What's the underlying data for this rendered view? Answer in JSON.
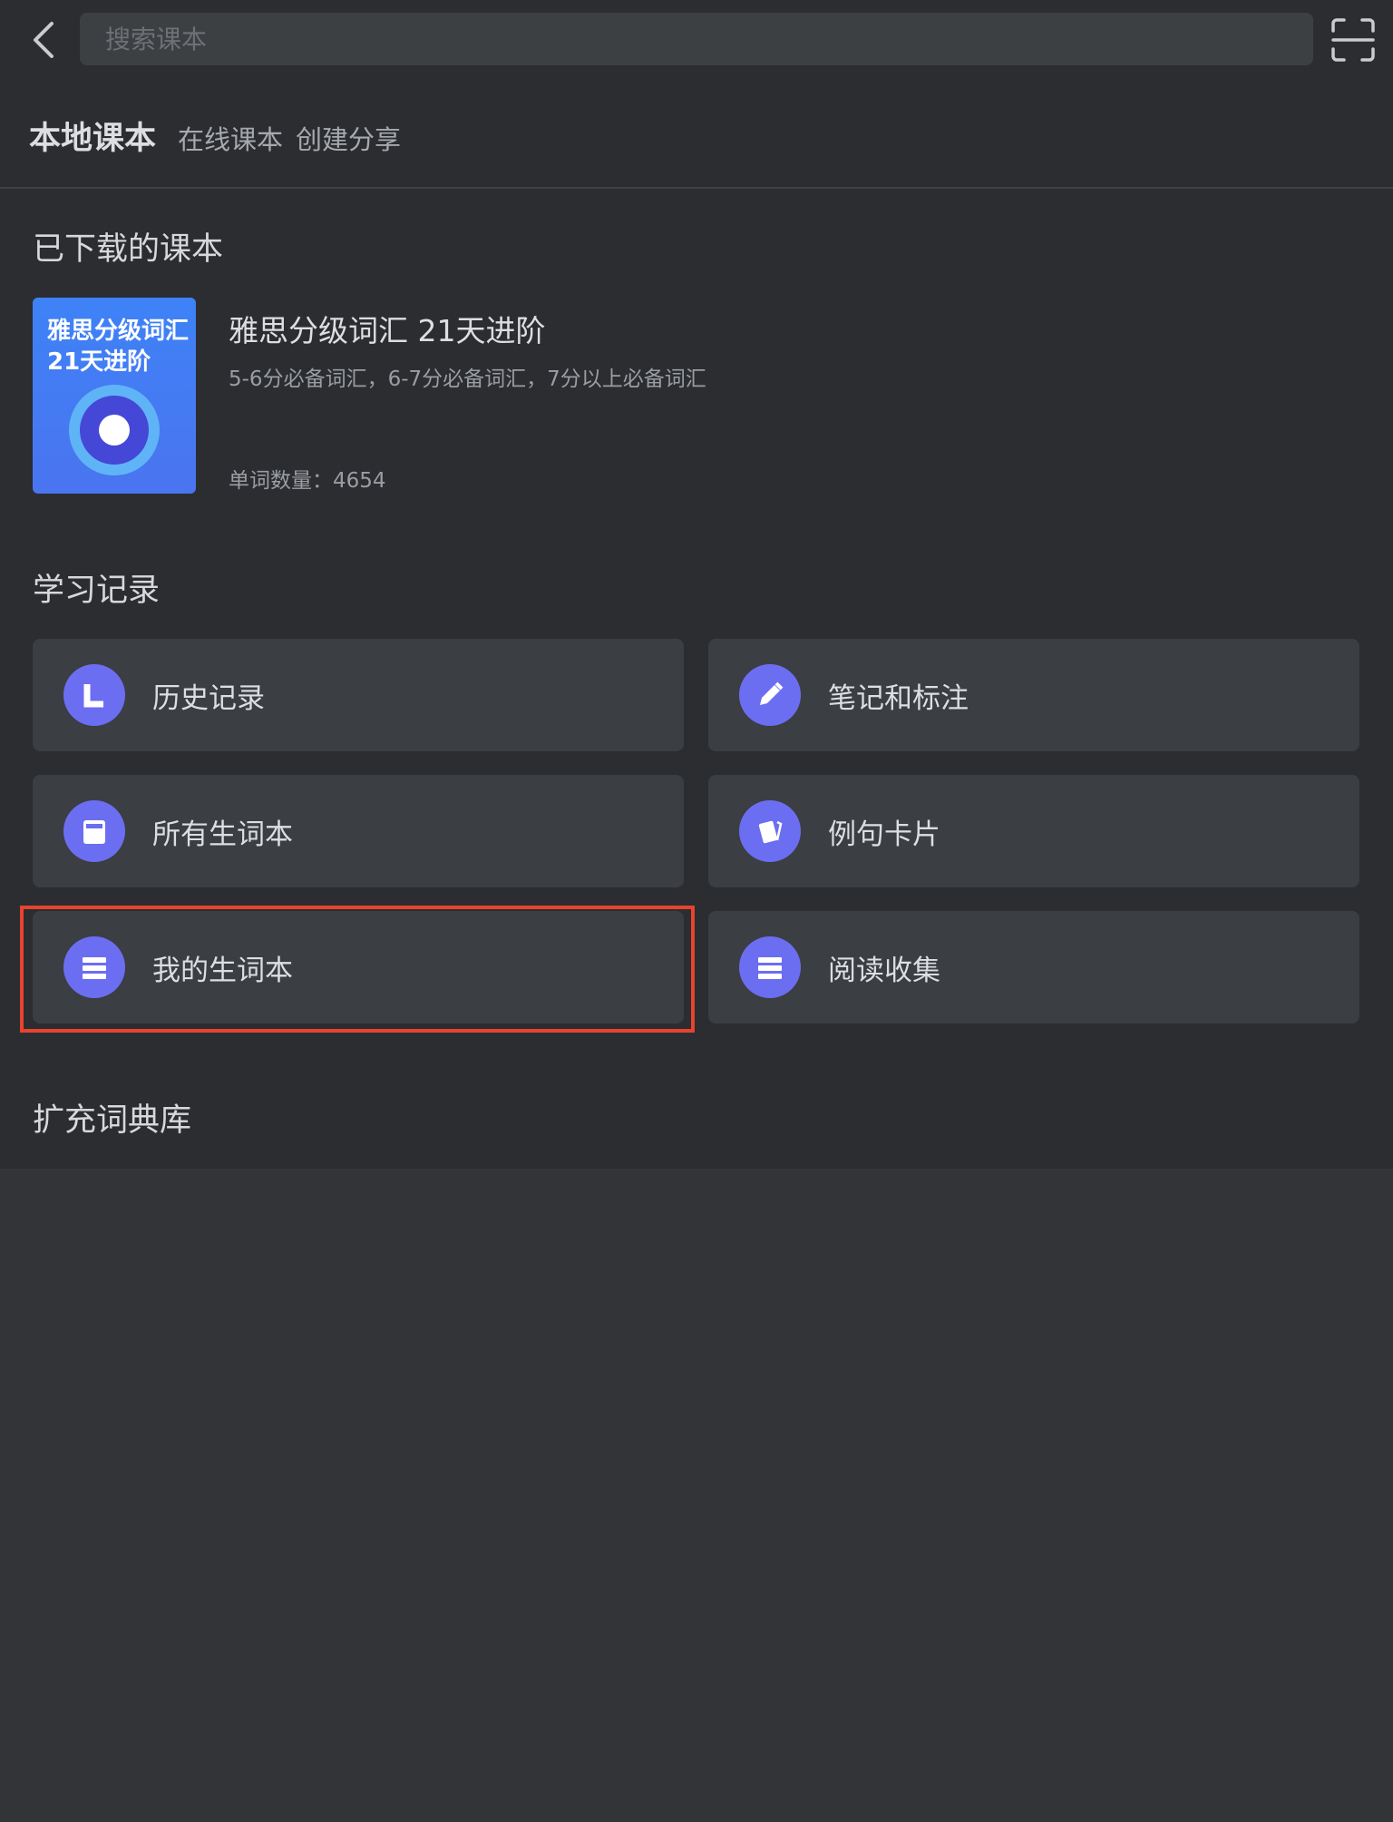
{
  "search": {
    "placeholder": "搜索课本"
  },
  "tabs": [
    {
      "label": "本地课本",
      "active": true
    },
    {
      "label": "在线课本",
      "active": false
    },
    {
      "label": "创建分享",
      "active": false
    }
  ],
  "downloaded": {
    "title": "已下载的课本",
    "book": {
      "cover_title": "雅思分级词汇21天进阶",
      "name": "雅思分级词汇 21天进阶",
      "description": "5-6分必备词汇，6-7分必备词汇，7分以上必备词汇",
      "word_count": "单词数量：4654"
    }
  },
  "records": {
    "title": "学习记录",
    "items": [
      {
        "label": "历史记录",
        "icon": "clock-icon"
      },
      {
        "label": "笔记和标注",
        "icon": "pencil-icon"
      },
      {
        "label": "所有生词本",
        "icon": "notebook-icon"
      },
      {
        "label": "例句卡片",
        "icon": "cards-icon"
      },
      {
        "label": "我的生词本",
        "icon": "list-icon"
      },
      {
        "label": "阅读收集",
        "icon": "list-icon"
      }
    ]
  },
  "dictionary": {
    "title": "扩充词典库"
  },
  "colors": {
    "accent": "#6c6ef2",
    "highlight": "#e8432e",
    "cover_blue": "#3e82f6"
  }
}
